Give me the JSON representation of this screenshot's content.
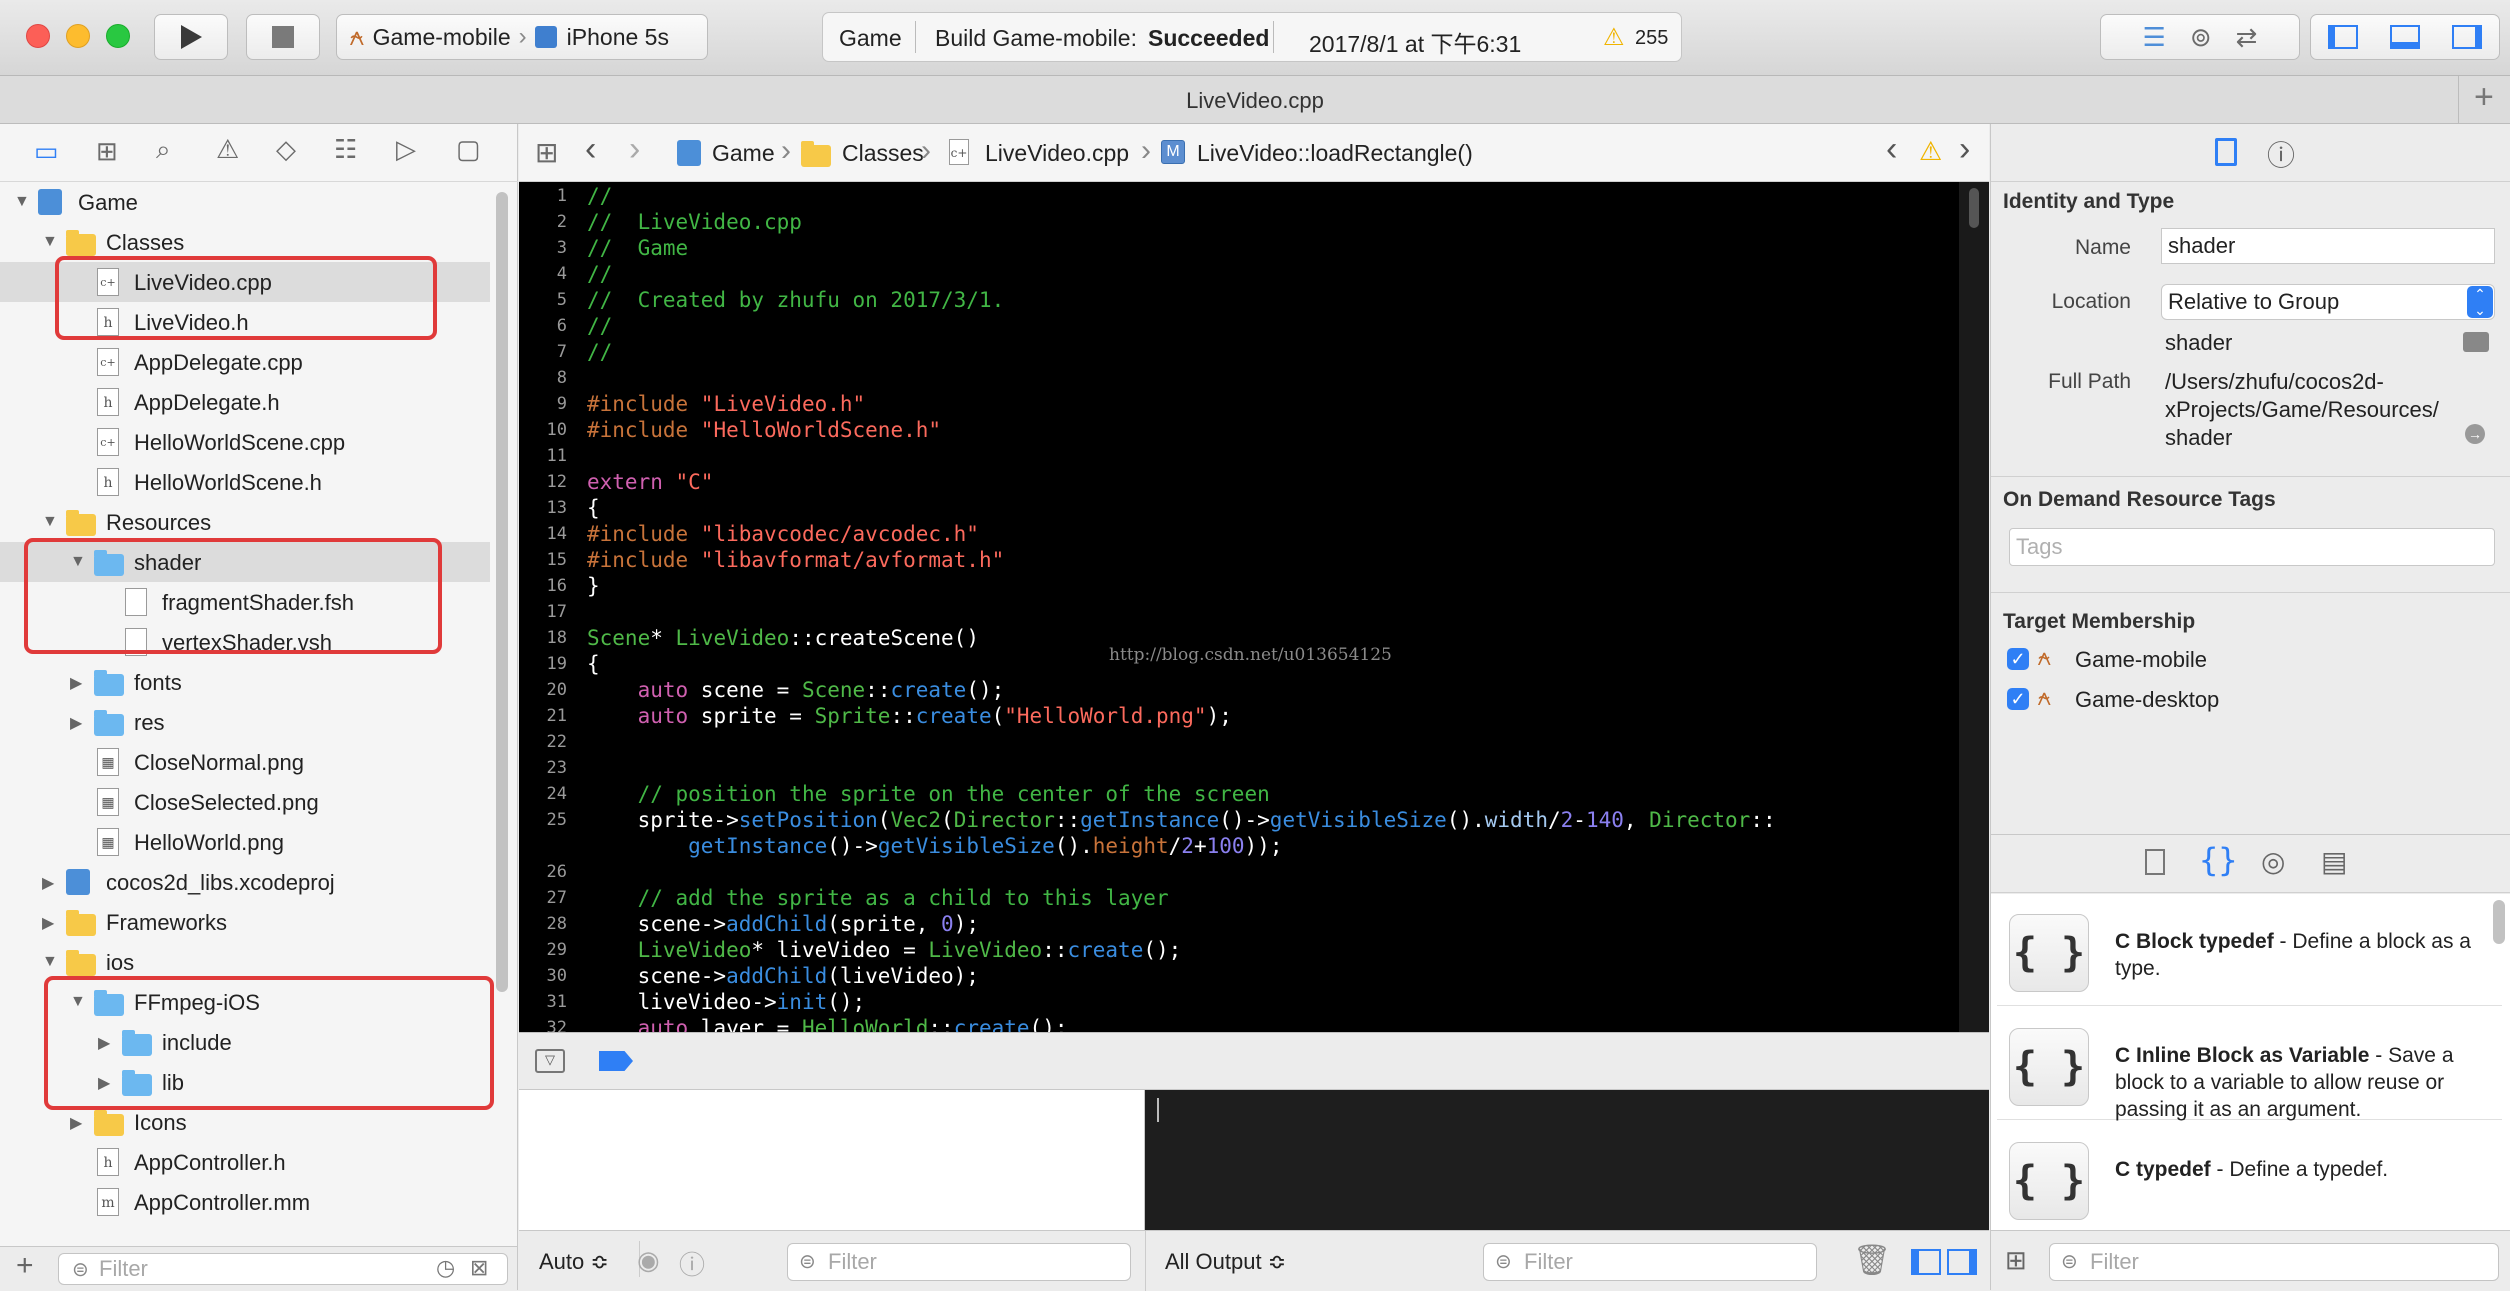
{
  "toolbar": {
    "scheme": "Game-mobile",
    "device": "iPhone 5s",
    "status_project": "Game",
    "status_prefix": "Build Game-mobile:",
    "status_result": "Succeeded",
    "status_time": "2017/8/1 at 下午6:31",
    "warning_count": "255"
  },
  "tab": {
    "title": "LiveVideo.cpp"
  },
  "jumpbar": {
    "crumbs": [
      "Game",
      "Classes",
      "LiveVideo.cpp",
      "LiveVideo::loadRectangle()"
    ]
  },
  "navigator": {
    "items": [
      {
        "label": "Game",
        "kind": "project"
      },
      {
        "label": "Classes",
        "kind": "folder"
      },
      {
        "label": "LiveVideo.cpp",
        "kind": "cpp"
      },
      {
        "label": "LiveVideo.h",
        "kind": "h"
      },
      {
        "label": "AppDelegate.cpp",
        "kind": "cpp"
      },
      {
        "label": "AppDelegate.h",
        "kind": "h"
      },
      {
        "label": "HelloWorldScene.cpp",
        "kind": "cpp"
      },
      {
        "label": "HelloWorldScene.h",
        "kind": "h"
      },
      {
        "label": "Resources",
        "kind": "folder"
      },
      {
        "label": "shader",
        "kind": "bluefolder"
      },
      {
        "label": "fragmentShader.fsh",
        "kind": "file"
      },
      {
        "label": "vertexShader.vsh",
        "kind": "file"
      },
      {
        "label": "fonts",
        "kind": "bluefolder"
      },
      {
        "label": "res",
        "kind": "bluefolder"
      },
      {
        "label": "CloseNormal.png",
        "kind": "png"
      },
      {
        "label": "CloseSelected.png",
        "kind": "png"
      },
      {
        "label": "HelloWorld.png",
        "kind": "png"
      },
      {
        "label": "cocos2d_libs.xcodeproj",
        "kind": "project"
      },
      {
        "label": "Frameworks",
        "kind": "folder"
      },
      {
        "label": "ios",
        "kind": "folder"
      },
      {
        "label": "FFmpeg-iOS",
        "kind": "bluefolder"
      },
      {
        "label": "include",
        "kind": "bluefolder"
      },
      {
        "label": "lib",
        "kind": "bluefolder"
      },
      {
        "label": "Icons",
        "kind": "folder"
      },
      {
        "label": "AppController.h",
        "kind": "h"
      },
      {
        "label": "AppController.mm",
        "kind": "mm"
      }
    ],
    "filter_placeholder": "Filter"
  },
  "editor": {
    "watermark": "http://blog.csdn.net/u013654125"
  },
  "debug": {
    "auto_label": "Auto ≎",
    "filter_placeholder": "Filter",
    "output_label": "All Output ≎",
    "console_filter": "Filter"
  },
  "inspector": {
    "identity_title": "Identity and Type",
    "name_label": "Name",
    "name_value": "shader",
    "location_label": "Location",
    "location_value": "Relative to Group",
    "location_path": "shader",
    "fullpath_label": "Full Path",
    "fullpath_lines": [
      "/Users/zhufu/cocos2d-",
      "xProjects/Game/Resources/",
      "shader"
    ],
    "tags_title": "On Demand Resource Tags",
    "tags_placeholder": "Tags",
    "membership_title": "Target Membership",
    "targets": [
      "Game-mobile",
      "Game-desktop"
    ],
    "library": [
      {
        "title": "C Block typedef",
        "desc": " - Define a block as a type."
      },
      {
        "title": "C Inline Block as Variable",
        "desc": " - Save a block to a variable to allow reuse or passing it as an argument."
      },
      {
        "title": "C typedef",
        "desc": " - Define a typedef."
      }
    ],
    "filter_placeholder": "Filter"
  }
}
